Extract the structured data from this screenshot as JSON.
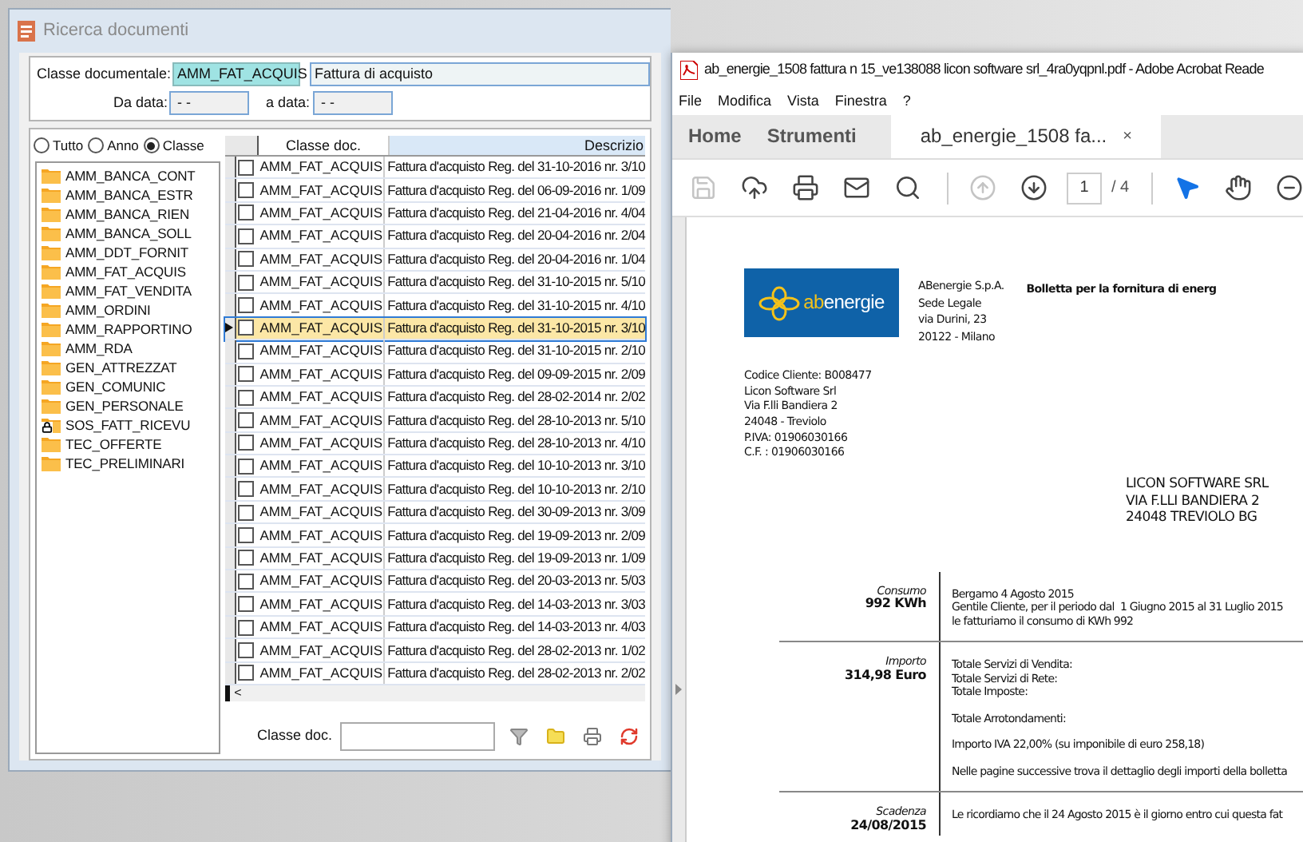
{
  "search_window": {
    "title": "Ricerca documenti",
    "filters": {
      "class_label": "Classe documentale:",
      "class_code": "AMM_FAT_ACQUIS",
      "class_name": "Fattura di acquisto",
      "from_label": "Da data:",
      "from_value": "- -",
      "to_label": "a data:",
      "to_value": "- -"
    },
    "view_options": [
      {
        "label": "Tutto",
        "selected": false
      },
      {
        "label": "Anno",
        "selected": false
      },
      {
        "label": "Classe",
        "selected": true
      }
    ],
    "classes": [
      {
        "name": "AMM_BANCA_CONT",
        "locked": false
      },
      {
        "name": "AMM_BANCA_ESTR",
        "locked": false
      },
      {
        "name": "AMM_BANCA_RIEN",
        "locked": false
      },
      {
        "name": "AMM_BANCA_SOLL",
        "locked": false
      },
      {
        "name": "AMM_DDT_FORNIT",
        "locked": false
      },
      {
        "name": "AMM_FAT_ACQUIS",
        "locked": false
      },
      {
        "name": "AMM_FAT_VENDITA",
        "locked": false
      },
      {
        "name": "AMM_ORDINI",
        "locked": false
      },
      {
        "name": "AMM_RAPPORTINO",
        "locked": false
      },
      {
        "name": "AMM_RDA",
        "locked": false
      },
      {
        "name": "GEN_ATTREZZAT",
        "locked": false
      },
      {
        "name": "GEN_COMUNIC",
        "locked": false
      },
      {
        "name": "GEN_PERSONALE",
        "locked": false
      },
      {
        "name": "SOS_FATT_RICEVU",
        "locked": true
      },
      {
        "name": "TEC_OFFERTE",
        "locked": false
      },
      {
        "name": "TEC_PRELIMINARI",
        "locked": false
      }
    ],
    "table": {
      "columns": [
        "Classe doc.",
        "Descrizio"
      ],
      "rows": [
        {
          "class": "AMM_FAT_ACQUIS",
          "description": "Fattura d'acquisto Reg. del 31-10-2016 nr. 3/10",
          "checked": false,
          "selected": false
        },
        {
          "class": "AMM_FAT_ACQUIS",
          "description": "Fattura d'acquisto Reg. del 06-09-2016 nr. 1/09",
          "checked": false,
          "selected": false
        },
        {
          "class": "AMM_FAT_ACQUIS",
          "description": "Fattura d'acquisto Reg. del 21-04-2016 nr. 4/04",
          "checked": false,
          "selected": false
        },
        {
          "class": "AMM_FAT_ACQUIS",
          "description": "Fattura d'acquisto Reg. del 20-04-2016 nr. 2/04",
          "checked": false,
          "selected": false
        },
        {
          "class": "AMM_FAT_ACQUIS",
          "description": "Fattura d'acquisto Reg. del 20-04-2016 nr. 1/04",
          "checked": false,
          "selected": false
        },
        {
          "class": "AMM_FAT_ACQUIS",
          "description": "Fattura d'acquisto Reg. del 31-10-2015 nr. 5/10",
          "checked": false,
          "selected": false
        },
        {
          "class": "AMM_FAT_ACQUIS",
          "description": "Fattura d'acquisto Reg. del 31-10-2015 nr. 4/10",
          "checked": false,
          "selected": false
        },
        {
          "class": "AMM_FAT_ACQUIS",
          "description": "Fattura d'acquisto Reg. del 31-10-2015 nr. 3/10",
          "checked": false,
          "selected": true
        },
        {
          "class": "AMM_FAT_ACQUIS",
          "description": "Fattura d'acquisto Reg. del 31-10-2015 nr. 2/10",
          "checked": false,
          "selected": false
        },
        {
          "class": "AMM_FAT_ACQUIS",
          "description": "Fattura d'acquisto Reg. del 09-09-2015 nr. 2/09",
          "checked": false,
          "selected": false
        },
        {
          "class": "AMM_FAT_ACQUIS",
          "description": "Fattura d'acquisto Reg. del 28-02-2014 nr. 2/02",
          "checked": false,
          "selected": false
        },
        {
          "class": "AMM_FAT_ACQUIS",
          "description": "Fattura d'acquisto Reg. del 28-10-2013 nr. 5/10",
          "checked": false,
          "selected": false
        },
        {
          "class": "AMM_FAT_ACQUIS",
          "description": "Fattura d'acquisto Reg. del 28-10-2013 nr. 4/10",
          "checked": false,
          "selected": false
        },
        {
          "class": "AMM_FAT_ACQUIS",
          "description": "Fattura d'acquisto Reg. del 10-10-2013 nr. 3/10",
          "checked": false,
          "selected": false
        },
        {
          "class": "AMM_FAT_ACQUIS",
          "description": "Fattura d'acquisto Reg. del 10-10-2013 nr. 2/10",
          "checked": false,
          "selected": false
        },
        {
          "class": "AMM_FAT_ACQUIS",
          "description": "Fattura d'acquisto Reg. del 30-09-2013 nr. 3/09",
          "checked": false,
          "selected": false
        },
        {
          "class": "AMM_FAT_ACQUIS",
          "description": "Fattura d'acquisto Reg. del 19-09-2013 nr. 2/09",
          "checked": false,
          "selected": false
        },
        {
          "class": "AMM_FAT_ACQUIS",
          "description": "Fattura d'acquisto Reg. del 19-09-2013 nr. 1/09",
          "checked": false,
          "selected": false
        },
        {
          "class": "AMM_FAT_ACQUIS",
          "description": "Fattura d'acquisto Reg. del 20-03-2013 nr. 5/03",
          "checked": false,
          "selected": false
        },
        {
          "class": "AMM_FAT_ACQUIS",
          "description": "Fattura d'acquisto Reg. del 14-03-2013 nr. 3/03",
          "checked": false,
          "selected": false
        },
        {
          "class": "AMM_FAT_ACQUIS",
          "description": "Fattura d'acquisto Reg. del 14-03-2013 nr. 4/03",
          "checked": false,
          "selected": false
        },
        {
          "class": "AMM_FAT_ACQUIS",
          "description": "Fattura d'acquisto Reg. del 28-02-2013 nr. 1/02",
          "checked": false,
          "selected": false
        },
        {
          "class": "AMM_FAT_ACQUIS",
          "description": "Fattura d'acquisto Reg. del 28-02-2013 nr. 2/02",
          "checked": false,
          "selected": false
        }
      ],
      "scroll_left": "<"
    },
    "bottom": {
      "class_label": "Classe doc."
    }
  },
  "reader": {
    "title": "ab_energie_1508 fattura n 15_ve138088 licon software srl_4ra0yqpnl.pdf - Adobe Acrobat Reade",
    "menu": [
      "File",
      "Modifica",
      "Vista",
      "Finestra",
      "?"
    ],
    "tabs": [
      {
        "label": "Home",
        "selected": false
      },
      {
        "label": "Strumenti",
        "selected": false
      },
      {
        "label": "ab_energie_1508 fa...",
        "selected": true,
        "close": "×"
      }
    ],
    "toolbar": {
      "buttons": [
        {
          "kind": "save",
          "disabled": true
        },
        {
          "kind": "upload",
          "disabled": false
        },
        {
          "kind": "print",
          "disabled": false
        },
        {
          "kind": "mail",
          "disabled": false
        },
        {
          "kind": "search",
          "disabled": false
        }
      ],
      "nav": [
        {
          "kind": "up",
          "disabled": true
        },
        {
          "kind": "down",
          "disabled": false
        }
      ],
      "page": "1",
      "pages": "/ 4",
      "tools": [
        {
          "kind": "select",
          "selected": true
        },
        {
          "kind": "hand",
          "selected": false
        },
        {
          "kind": "zoom_out",
          "selected": false
        }
      ]
    },
    "document": {
      "logo": {
        "prefix": "ab",
        "text": "energie"
      },
      "sender": [
        "ABenergie S.p.A.",
        "Sede Legale",
        "via Durini, 23",
        "20122 - Milano"
      ],
      "heading": "Bolletta per la fornitura di energ",
      "customer": [
        "Codice Cliente: B008477",
        "Licon Software Srl",
        "Via F.lli Bandiera 2",
        "24048 - Treviolo",
        "P.IVA: 01906030166",
        "C.F. : 01906030166"
      ],
      "recipient": [
        "LICON SOFTWARE SRL",
        "VIA F.LLI BANDIERA 2",
        "24048 TREVIOLO BG"
      ],
      "sections": [
        {
          "label": "Consumo",
          "value": "992 KWh",
          "paragraphs": [
            [
              "Bergamo 4 Agosto 2015",
              "Gentile Cliente, per il periodo dal  1 Giugno 2015 al 31 Luglio 2015",
              "le fatturiamo il consumo di KWh 992"
            ]
          ]
        },
        {
          "label": "Importo",
          "value": "314,98 Euro",
          "paragraphs": [
            [
              "Totale Servizi di Vendita:",
              "Totale Servizi di Rete:",
              "Totale Imposte:"
            ],
            [
              "Totale Arrotondamenti:"
            ],
            [
              "Importo IVA 22,00% (su imponibile di euro 258,18)"
            ],
            [
              "Nelle pagine successive trova il dettaglio degli importi della bolletta"
            ]
          ]
        },
        {
          "label": "Scadenza",
          "value": "24/08/2015",
          "paragraphs": [
            [
              "Le ricordiamo che il 24 Agosto 2015 è il giorno entro cui questa fat"
            ]
          ]
        }
      ]
    }
  }
}
